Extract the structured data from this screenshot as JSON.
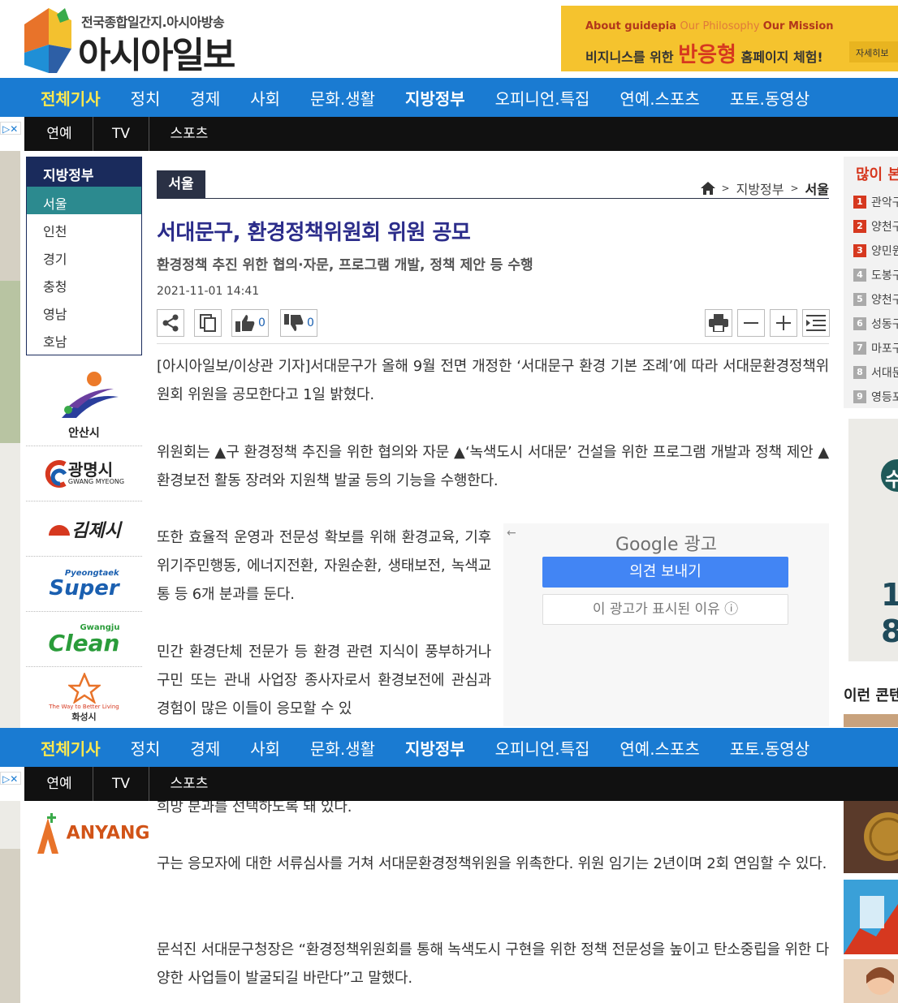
{
  "header": {
    "logo_sub": "전국종합일간지.아시아방송",
    "logo_main": "아시아일보",
    "banner": {
      "line1_a": "About guidepia ",
      "line1_b": "Our Philosophy ",
      "line1_c": "Our Mission",
      "line2_a": "비지니스를 위한 ",
      "line2_big": "반응형",
      "line2_b": " 홈페이지 체험!",
      "btn": "자세히보"
    }
  },
  "nav": {
    "items": [
      "전체기사",
      "정치",
      "경제",
      "사회",
      "문화.생활",
      "지방정부",
      "오피니언.특집",
      "연예.스포츠",
      "포토.동영상"
    ]
  },
  "subnav": {
    "items": [
      "연예",
      "TV",
      "스포츠"
    ]
  },
  "ad_close": "▷✕",
  "sidebar": {
    "title": "지방정부",
    "items": [
      "서울",
      "인천",
      "경기",
      "충청",
      "영남",
      "호남"
    ]
  },
  "cities": {
    "ansan": "안산시",
    "gwangmyeong": "광명시",
    "gwangmyeong_en": "GWANG MYEONG",
    "gimje": "김제시",
    "pyeongtaek_small": "Pyeongtaek",
    "pyeongtaek": "Super",
    "gwangju_small": "Gwangju",
    "gwangju": "Clean",
    "hwaseong_en": "The Way to Better Living",
    "hwaseong": "화성시",
    "anyang": "ANYANG"
  },
  "article": {
    "category": "서울",
    "breadcrumb": [
      "지방정부",
      "서울"
    ],
    "title": "서대문구, 환경정책위원회 위원 공모",
    "subtitle": "환경정책 추진 위한 협의·자문, 프로그램 개발, 정책 제안 등 수행",
    "date": "2021-11-01 14:41",
    "likes": "0",
    "dislikes": "0",
    "p1": "[아시아일보/이상관 기자]서대문구가 올해 9월 전면 개정한 ‘서대문구 환경 기본 조례’에 따라 서대문환경정책위원회 위원을 공모한다고 1일 밝혔다.",
    "p2": "위원회는 ▲구 환경정책 추진을 위한 협의와 자문 ▲‘녹색도시 서대문’ 건설을 위한 프로그램 개발과 정책 제안 ▲환경보전 활동 장려와 지원책 발굴 등의 기능을 수행한다.",
    "p3": "또한 효율적 운영과 전문성 확보를 위해 환경교육, 기후위기주민행동, 에너지전환, 자원순환, 생태보전, 녹색교통 등 6개 분과를 둔다.",
    "p4": "민간 환경단체 전문가 등 환경 관련 지식이 풍부하거나 구민 또는 관내 사업장 종사자로서 환경보전에 관심과 경험이 많은 이들이 응모할 수 있",
    "p5": "희망 분과를 선택하도록 돼 있다.",
    "p6": "구는 응모자에 대한 서류심사를 거쳐 서대문환경정책위원을 위촉한다. 위원 임기는 2년이며 2회 연임할 수 있다.",
    "p7": "문석진 서대문구청장은 “환경정책위원회를 통해 녹색도시 구현을 위한 정책 전문성을 높이고 탄소중립을 위한 다양한 사업들이 발굴되길 바란다”고 말했다."
  },
  "google_ad": {
    "back": "←",
    "title": "Google 광고",
    "feedback": "의견 보내기",
    "why": "이 광고가 표시된 이유 ⓘ"
  },
  "popular": {
    "title": "많이 본",
    "items": [
      {
        "num": "1",
        "text": "관악구"
      },
      {
        "num": "2",
        "text": "양천구"
      },
      {
        "num": "3",
        "text": "양민원"
      },
      {
        "num": "4",
        "text": "도봉구"
      },
      {
        "num": "5",
        "text": "양천구"
      },
      {
        "num": "6",
        "text": "성동구"
      },
      {
        "num": "7",
        "text": "마포구"
      },
      {
        "num": "8",
        "text": "서대문"
      },
      {
        "num": "9",
        "text": "영등포"
      }
    ]
  },
  "right_ad": {
    "t1": "수",
    "t2": "1",
    "t3": "8"
  },
  "right_head": "이런 콘텐"
}
